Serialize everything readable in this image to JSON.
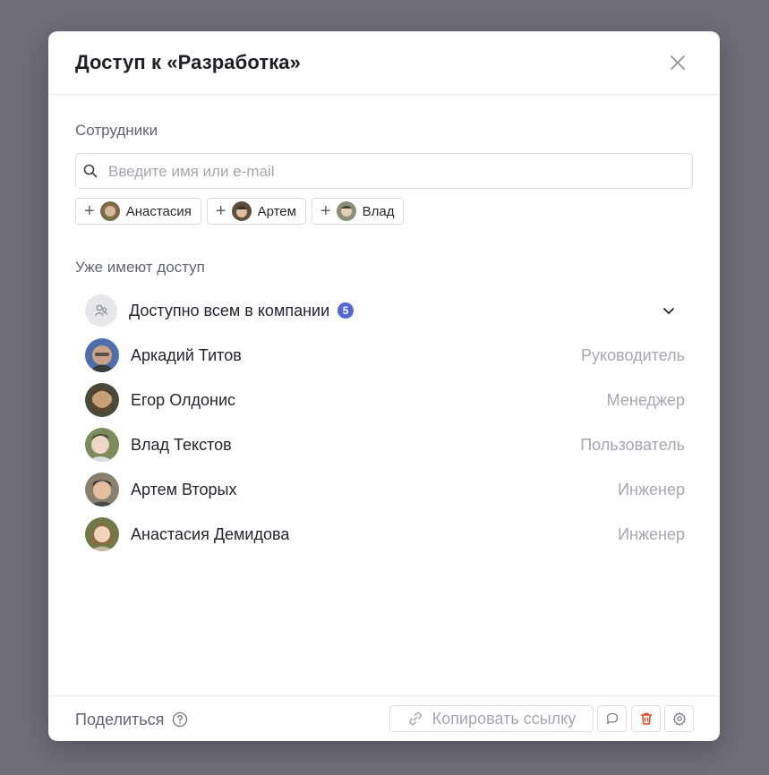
{
  "modal": {
    "title": "Доступ к «Разработка»"
  },
  "employees": {
    "label": "Сотрудники",
    "search_placeholder": "Введите имя или e-mail",
    "suggestions": [
      {
        "name": "Анастасия"
      },
      {
        "name": "Артем"
      },
      {
        "name": "Влад"
      }
    ]
  },
  "access": {
    "label": "Уже имеют доступ",
    "company": {
      "label": "Доступно всем в компании",
      "count": "5"
    },
    "members": [
      {
        "name": "Аркадий Титов",
        "role": "Руководитель"
      },
      {
        "name": "Егор Олдонис",
        "role": "Менеджер"
      },
      {
        "name": "Влад Текстов",
        "role": "Пользователь"
      },
      {
        "name": "Артем Вторых",
        "role": "Инженер"
      },
      {
        "name": "Анастасия Демидова",
        "role": "Инженер"
      }
    ]
  },
  "footer": {
    "share_label": "Поделиться",
    "copy_link_label": "Копировать ссылку"
  },
  "colors": {
    "accent": "#5766d6",
    "danger": "#d9481f",
    "backdrop": "#6e6e78"
  },
  "icons": [
    "close-icon",
    "search-icon",
    "plus-icon",
    "group-icon",
    "chevron-down-icon",
    "help-icon",
    "link-icon",
    "comment-icon",
    "trash-icon",
    "gear-icon"
  ]
}
